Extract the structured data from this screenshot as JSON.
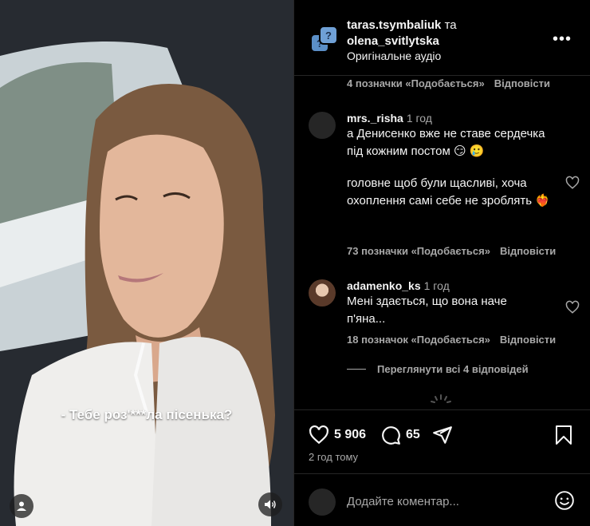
{
  "video": {
    "subtitle": "- Тебе роз'***ла пісенька?"
  },
  "header": {
    "user1": "taras.tsymbaliuk",
    "joiner": "та",
    "user2": "olena_svitlytska",
    "audio": "Оригінальне аудіо",
    "more_label": "•••"
  },
  "comments": {
    "top_meta": {
      "likes": "4 позначки «Подобається»",
      "reply": "Відповісти"
    },
    "items": [
      {
        "username": "mrs._risha",
        "time": "1 год",
        "text1": "а Денисенко вже не ставе сердечка під кожним постом 😏 🥲",
        "text2": "головне щоб були щасливі, хоча охоплення самі себе не зроблять ❤️‍🔥",
        "likes": "73 позначки «Подобається»",
        "reply": "Відповісти"
      },
      {
        "username": "adamenko_ks",
        "time": "1 год",
        "text": "Мені здається, що вона наче п'яна...",
        "likes": "18 позначок «Подобається»",
        "reply": "Відповісти"
      }
    ],
    "view_replies": "Переглянути всі 4 відповідей"
  },
  "actions": {
    "likes_count": "5 906",
    "comments_count": "65",
    "posted": "2 год тому"
  },
  "add_comment": {
    "placeholder": "Додайте коментар..."
  }
}
